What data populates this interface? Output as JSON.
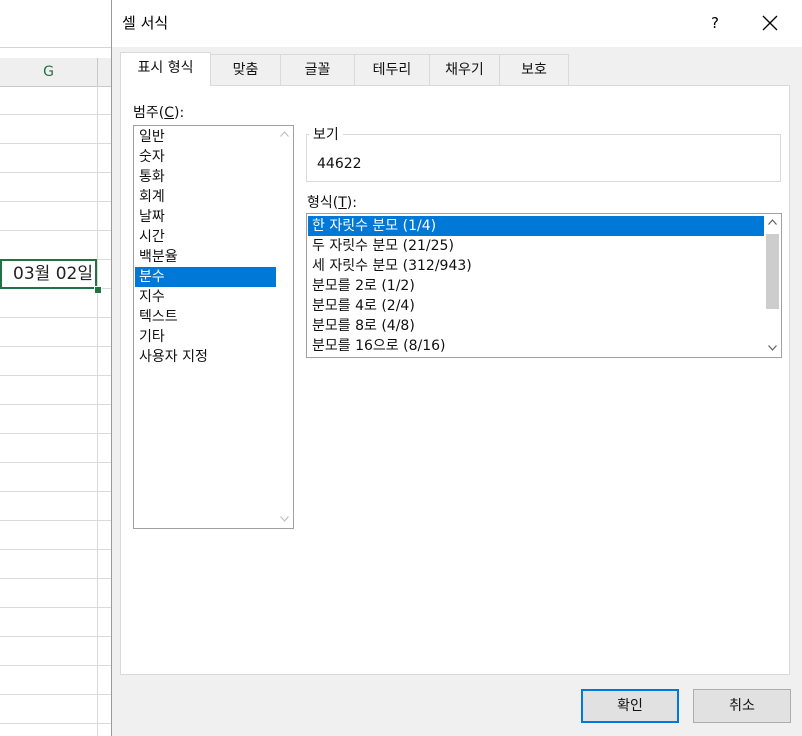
{
  "sheet": {
    "column_header": "G",
    "active_cell_value": "03월 02일"
  },
  "dialog": {
    "title": "셀 서식",
    "help_label": "?",
    "tabs": [
      {
        "label": "표시 형식",
        "active": true
      },
      {
        "label": "맞춤",
        "active": false
      },
      {
        "label": "글꼴",
        "active": false
      },
      {
        "label": "테두리",
        "active": false
      },
      {
        "label": "채우기",
        "active": false
      },
      {
        "label": "보호",
        "active": false
      }
    ],
    "category": {
      "label_prefix": "범주(",
      "label_accel": "C",
      "label_suffix": "):",
      "items": [
        "일반",
        "숫자",
        "통화",
        "회계",
        "날짜",
        "시간",
        "백분율",
        "분수",
        "지수",
        "텍스트",
        "기타",
        "사용자 지정"
      ],
      "selected_index": 7
    },
    "sample": {
      "title": "보기",
      "value": "44622"
    },
    "type": {
      "label_prefix": "형식(",
      "label_accel": "T",
      "label_suffix": "):",
      "items": [
        "한 자릿수 분모 (1/4)",
        "두 자릿수 분모 (21/25)",
        "세 자릿수 분모 (312/943)",
        "분모를 2로 (1/2)",
        "분모를 4로 (2/4)",
        "분모를 8로 (4/8)",
        "분모를 16으로 (8/16)"
      ],
      "selected_index": 0
    },
    "buttons": {
      "ok": "확인",
      "cancel": "취소"
    },
    "colors": {
      "selection": "#0078d7",
      "sheet_accent": "#217346"
    },
    "icons": {
      "close": "close-icon",
      "scroll_up": "chevron-up-icon",
      "scroll_down": "chevron-down-icon"
    }
  }
}
